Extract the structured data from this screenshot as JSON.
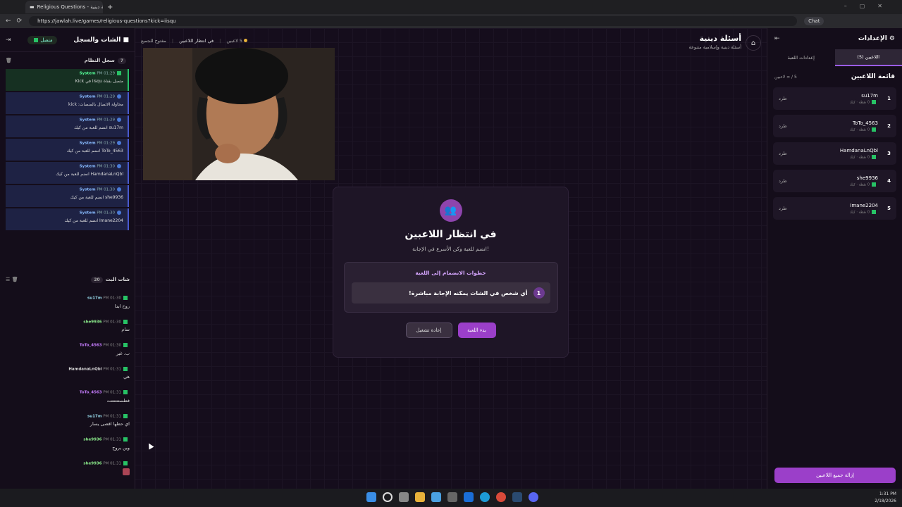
{
  "browser": {
    "tab_title": "Religious Questions - أسئلة دينية",
    "url": "https://jawlah.live/games/religious-questions?kick=iisqu",
    "chat_button": "Chat"
  },
  "left": {
    "title": "الشات والسجل",
    "status": "متصل",
    "syslog_title": "سجل النظام",
    "syslog_count": "7",
    "log": [
      {
        "user": "System",
        "time": "PM 01:29",
        "text": "متصل بقناة iisqu في Kick"
      },
      {
        "user": "System",
        "time": "PM 01:29",
        "text": "محاولة الاتصال بالمنصات: kick"
      },
      {
        "user": "System",
        "time": "PM 01:29",
        "text": "su17m انضم للعبة من كيك"
      },
      {
        "user": "System",
        "time": "PM 01:29",
        "text": "ToTo_4563 انضم للعبة من كيك"
      },
      {
        "user": "System",
        "time": "PM 01:30",
        "text": "HamdanaLnQbl انضم للعبة من كيك"
      },
      {
        "user": "System",
        "time": "PM 01:30",
        "text": "she9936 انضم للعبة من كيك"
      },
      {
        "user": "System",
        "time": "PM 01:30",
        "text": "Imane2204 انضم للعبة من كيك"
      }
    ],
    "chat_title": "شات البث",
    "chat_count": "20",
    "chat": [
      {
        "user": "su17m",
        "time": "PM 01:30",
        "text": "روح ابدا"
      },
      {
        "user": "she9936",
        "time": "PM 01:30",
        "text": "تمام"
      },
      {
        "user": "ToTo_4563",
        "time": "PM 01:30",
        "text": "ب. غير"
      },
      {
        "user": "HamdanaLnQbl",
        "time": "PM 01:31",
        "text": "هي"
      },
      {
        "user": "ToTo_4563",
        "time": "PM 01:31",
        "text": "فطستتتتتتت"
      },
      {
        "user": "su17m",
        "time": "PM 01:31",
        "text": "اي حطها اقصى يسار"
      },
      {
        "user": "she9936",
        "time": "PM 01:31",
        "text": "وين يروح"
      },
      {
        "user": "she9936",
        "time": "PM 01:31",
        "text": ""
      }
    ]
  },
  "top": {
    "players_count": "5 لاعبين",
    "state": "في انتظار اللاعبين",
    "open": "مفتوح للجميع",
    "game_title": "أسئلة دينية",
    "game_sub": "أسئلة دينية وإسلامية متنوعة"
  },
  "waiting": {
    "title": "في انتظار اللاعبين",
    "subtitle": "انضم للعبة وكن الأسرع في الإجابة!",
    "steps_title": "خطوات الانضمام إلى اللعبة",
    "step_num": "1",
    "step_text": "أي شخص في الشات يمكنه الإجابة مباشرة!",
    "start": "بدء اللعبة",
    "reset": "إعادة تشغيل"
  },
  "right": {
    "title": "الإعدادات",
    "tab_players": "اللاعبين (5)",
    "tab_settings": "إعدادات اللعبة",
    "list_title": "قائمة اللاعبين",
    "list_count": "5 / ∞ لاعبين",
    "kick_label": "طرد",
    "players": [
      {
        "num": "1",
        "name": "su17m",
        "meta": "0 نقطة · كيك"
      },
      {
        "num": "2",
        "name": "ToTo_4563",
        "meta": "0 نقطة · كيك"
      },
      {
        "num": "3",
        "name": "HamdanaLnQbl",
        "meta": "0 نقطة · كيك"
      },
      {
        "num": "4",
        "name": "she9936",
        "meta": "0 نقطة · كيك"
      },
      {
        "num": "5",
        "name": "Imane2204",
        "meta": "0 نقطة · كيك"
      }
    ],
    "remove_all": "إزالة جميع اللاعبين"
  },
  "taskbar": {
    "time": "1:31 PM",
    "date": "2/18/2026"
  }
}
